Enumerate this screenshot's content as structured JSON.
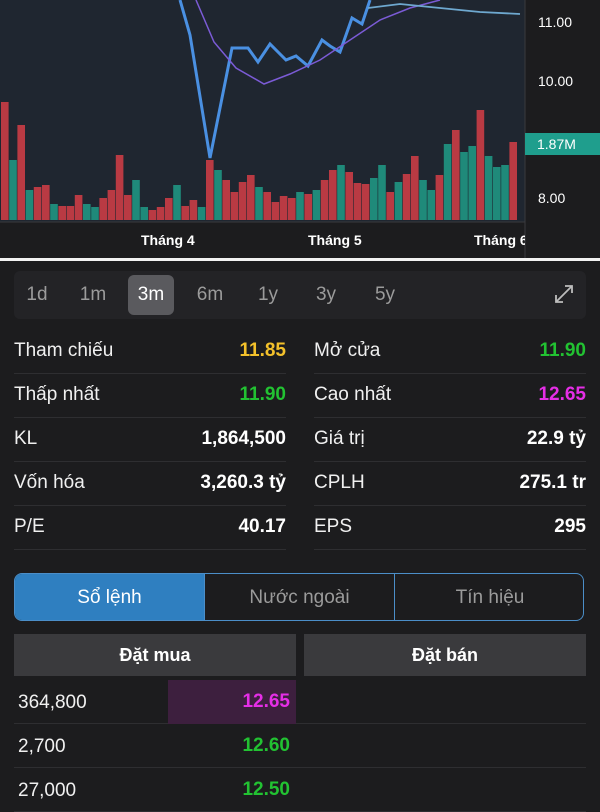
{
  "chart": {
    "x_labels": [
      "Tháng 4",
      "Tháng 5",
      "Tháng 6"
    ],
    "y_labels": [
      "11.00",
      "10.00",
      "8.00"
    ],
    "volume_badge": "1.87M",
    "colors": {
      "up": "#1f8a7a",
      "down": "#b93a43",
      "price_line": "#4a90e2",
      "ma_line": "#7b5bd6",
      "ma_long_line": "#6ea8cf"
    }
  },
  "range_tabs": [
    {
      "label": "1d",
      "active": false
    },
    {
      "label": "1m",
      "active": false
    },
    {
      "label": "3m",
      "active": true
    },
    {
      "label": "6m",
      "active": false
    },
    {
      "label": "1y",
      "active": false
    },
    {
      "label": "3y",
      "active": false
    },
    {
      "label": "5y",
      "active": false
    }
  ],
  "stats": {
    "left": [
      {
        "label": "Tham chiếu",
        "value": "11.85",
        "color": "yellow"
      },
      {
        "label": "Thấp nhất",
        "value": "11.90",
        "color": "green"
      },
      {
        "label": "KL",
        "value": "1,864,500",
        "color": "white"
      },
      {
        "label": "Vốn hóa",
        "value": "3,260.3 tỷ",
        "color": "white"
      },
      {
        "label": "P/E",
        "value": "40.17",
        "color": "white"
      }
    ],
    "right": [
      {
        "label": "Mở cửa",
        "value": "11.90",
        "color": "green"
      },
      {
        "label": "Cao nhất",
        "value": "12.65",
        "color": "magenta"
      },
      {
        "label": "Giá trị",
        "value": "22.9 tỷ",
        "color": "white"
      },
      {
        "label": "CPLH",
        "value": "275.1 tr",
        "color": "white"
      },
      {
        "label": "EPS",
        "value": "295",
        "color": "white"
      }
    ]
  },
  "order_tabs": [
    {
      "label": "Sổ lệnh",
      "active": true
    },
    {
      "label": "Nước ngoài",
      "active": false
    },
    {
      "label": "Tín hiệu",
      "active": false
    }
  ],
  "order_book": {
    "buy_header": "Đặt mua",
    "sell_header": "Đặt bán",
    "rows": [
      {
        "qty": "364,800",
        "price": "12.65",
        "color": "magenta"
      },
      {
        "qty": "2,700",
        "price": "12.60",
        "color": "green"
      },
      {
        "qty": "27,000",
        "price": "12.50",
        "color": "green"
      }
    ]
  }
}
